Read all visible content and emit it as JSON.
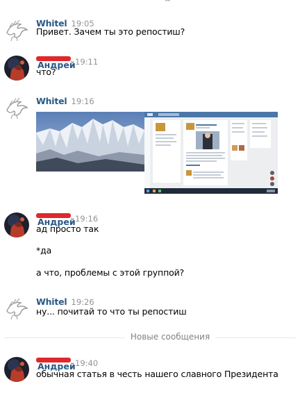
{
  "top_fragment": "д",
  "messages": [
    {
      "author": "Whitel",
      "time": "19:05",
      "lines": [
        "Привет. Зачем ты это репостиш?"
      ]
    },
    {
      "author": "Андрей",
      "time": "19:11",
      "lines": [
        "что?"
      ]
    },
    {
      "author": "Whitel",
      "time": "19:16",
      "lines": []
    },
    {
      "author": "Андрей",
      "time": "19:16",
      "lines": [
        "ад просто так",
        "*да",
        "а что, проблемы с этой группой?"
      ]
    },
    {
      "author": "Whitel",
      "time": "19:26",
      "lines": [
        "ну... почитай то что ты репостиш"
      ]
    },
    {
      "author": "Андрей",
      "time": "19:40",
      "lines": [
        "обычная статья в честь нашего славного Президента"
      ]
    }
  ],
  "divider_label": "Новые сообщения",
  "colors": {
    "author_link": "#2a5885",
    "timestamp": "#939393",
    "redaction": "#e0282c",
    "divider": "#e7e8ec"
  }
}
